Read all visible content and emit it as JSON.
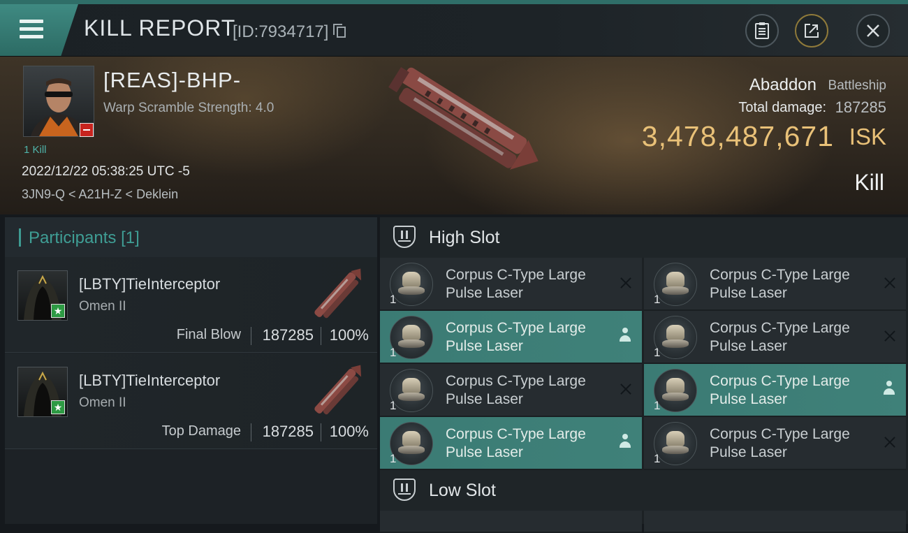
{
  "header": {
    "title": "KILL REPORT",
    "report_id": "[ID:7934717]",
    "buttons": [
      "clipboard",
      "share",
      "close"
    ]
  },
  "victim": {
    "name": "[REAS]-BHP-",
    "warp_scramble": "Warp Scramble Strength: 4.0",
    "kills": "1 Kill",
    "datetime": "2022/12/22 05:38:25 UTC -5",
    "location": "3JN9-Q < A21H-Z < Deklein",
    "ship_name": "Abaddon",
    "ship_class": "Battleship",
    "total_damage_label": "Total damage:",
    "total_damage": "187285",
    "isk_value": "3,478,487,671",
    "isk_unit": "ISK",
    "result": "Kill"
  },
  "participants": {
    "title": "Participants",
    "count": "[1]",
    "rows": [
      {
        "name": "[LBTY]TieInterceptor",
        "ship": "Omen II",
        "role": "Final Blow",
        "damage": "187285",
        "percent": "100%"
      },
      {
        "name": "[LBTY]TieInterceptor",
        "ship": "Omen II",
        "role": "Top Damage",
        "damage": "187285",
        "percent": "100%"
      }
    ]
  },
  "high_slot": {
    "title": "High Slot",
    "modules": [
      {
        "name": "Corpus C-Type Large Pulse Laser",
        "qty": "1",
        "status": "destroyed"
      },
      {
        "name": "Corpus C-Type Large Pulse Laser",
        "qty": "1",
        "status": "destroyed"
      },
      {
        "name": "Corpus C-Type Large Pulse Laser",
        "qty": "1",
        "status": "dropped"
      },
      {
        "name": "Corpus C-Type Large Pulse Laser",
        "qty": "1",
        "status": "destroyed"
      },
      {
        "name": "Corpus C-Type Large Pulse Laser",
        "qty": "1",
        "status": "destroyed"
      },
      {
        "name": "Corpus C-Type Large Pulse Laser",
        "qty": "1",
        "status": "dropped"
      },
      {
        "name": "Corpus C-Type Large Pulse Laser",
        "qty": "1",
        "status": "dropped"
      },
      {
        "name": "Corpus C-Type Large Pulse Laser",
        "qty": "1",
        "status": "destroyed"
      }
    ]
  },
  "low_slot": {
    "title": "Low Slot"
  },
  "colors": {
    "accent_teal": "#3e9b92",
    "isk_gold": "#e9c178",
    "security_red": "#c8241e",
    "standing_green": "#2d9a43"
  }
}
